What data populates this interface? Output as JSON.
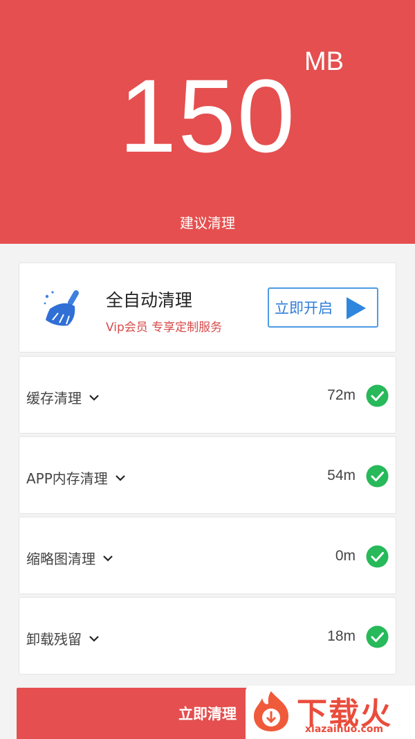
{
  "header": {
    "size_value": "150",
    "size_unit": "MB",
    "suggest_text": "建议清理"
  },
  "promo": {
    "title": "全自动清理",
    "subtitle": "Vip会员 专享定制服务",
    "button_label": "立即开启",
    "icon": "broom-icon"
  },
  "rows": [
    {
      "label": "缓存清理",
      "value": "72m",
      "checked": true
    },
    {
      "label": "APP内存清理",
      "value": "54m",
      "checked": true
    },
    {
      "label": "缩略图清理",
      "value": "0m",
      "checked": true
    },
    {
      "label": "卸载残留",
      "value": "18m",
      "checked": true
    }
  ],
  "clean_button_label": "立即清理",
  "watermark": {
    "text": "下载火",
    "url": "xiazaihuo.com"
  },
  "colors": {
    "accent": "#e54f4f",
    "check": "#27b95a",
    "link_blue": "#2f7ed8"
  }
}
